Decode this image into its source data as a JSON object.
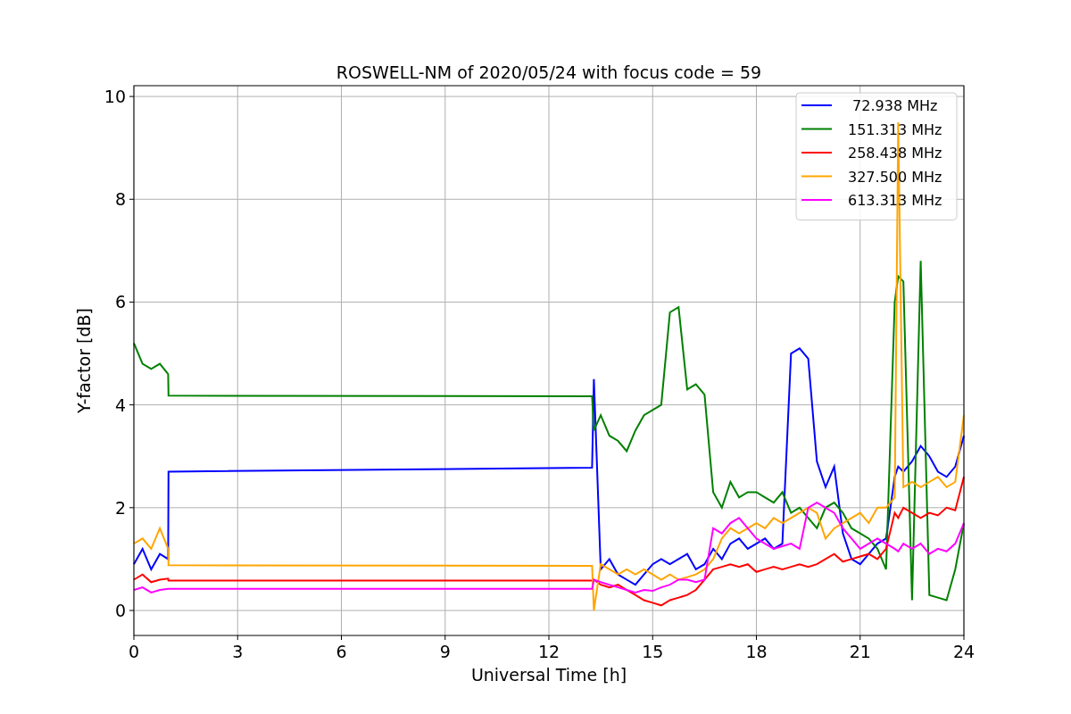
{
  "chart_data": {
    "type": "line",
    "title": "ROSWELL-NM of 2020/05/24 with focus code = 59",
    "xlabel": "Universal Time [h]",
    "ylabel": "Y-factor [dB]",
    "x": [
      0,
      0.25,
      0.5,
      0.75,
      0.99,
      1.0,
      13.25,
      13.3,
      13.5,
      13.75,
      14,
      14.25,
      14.5,
      14.75,
      15,
      15.25,
      15.5,
      15.75,
      16,
      16.25,
      16.5,
      16.75,
      17,
      17.25,
      17.5,
      17.75,
      18,
      18.25,
      18.5,
      18.75,
      19,
      19.25,
      19.5,
      19.75,
      20,
      20.25,
      20.5,
      20.75,
      21,
      21.25,
      21.5,
      21.75,
      22,
      22.1,
      22.25,
      22.5,
      22.75,
      23,
      23.25,
      23.5,
      23.75,
      24
    ],
    "series": [
      {
        "name": " 72.938 MHz",
        "color": "#0000ff",
        "values": [
          0.9,
          1.2,
          0.8,
          1.1,
          1.0,
          2.7,
          2.78,
          4.5,
          0.8,
          1.0,
          0.7,
          0.6,
          0.5,
          0.7,
          0.9,
          1.0,
          0.9,
          1.0,
          1.1,
          0.8,
          0.9,
          1.2,
          1.0,
          1.3,
          1.4,
          1.2,
          1.3,
          1.4,
          1.2,
          1.3,
          5.0,
          5.1,
          4.9,
          2.9,
          2.4,
          2.8,
          1.5,
          1.0,
          0.9,
          1.1,
          1.3,
          1.4,
          2.6,
          2.8,
          2.7,
          2.9,
          3.2,
          3.0,
          2.7,
          2.6,
          2.8,
          3.4
        ]
      },
      {
        "name": "151.313 MHz",
        "color": "#008000",
        "values": [
          5.2,
          4.8,
          4.7,
          4.8,
          4.6,
          4.18,
          4.17,
          3.5,
          3.8,
          3.4,
          3.3,
          3.1,
          3.5,
          3.8,
          3.9,
          4.0,
          5.8,
          5.9,
          4.3,
          4.4,
          4.2,
          2.3,
          2.0,
          2.5,
          2.2,
          2.3,
          2.3,
          2.2,
          2.1,
          2.3,
          1.9,
          2.0,
          1.8,
          1.6,
          2.0,
          2.1,
          1.9,
          1.6,
          1.5,
          1.4,
          1.2,
          0.8,
          6.0,
          6.5,
          6.4,
          0.2,
          6.8,
          0.3,
          0.25,
          0.2,
          0.8,
          1.7
        ]
      },
      {
        "name": "258.438 MHz",
        "color": "#ff0000",
        "values": [
          0.6,
          0.7,
          0.55,
          0.6,
          0.62,
          0.58,
          0.58,
          0.6,
          0.5,
          0.45,
          0.5,
          0.4,
          0.3,
          0.2,
          0.15,
          0.1,
          0.2,
          0.25,
          0.3,
          0.4,
          0.6,
          0.8,
          0.85,
          0.9,
          0.85,
          0.9,
          0.75,
          0.8,
          0.85,
          0.8,
          0.85,
          0.9,
          0.85,
          0.9,
          1.0,
          1.1,
          0.95,
          1.0,
          1.05,
          1.1,
          1.0,
          1.2,
          1.9,
          1.8,
          2.0,
          1.9,
          1.8,
          1.9,
          1.85,
          2.0,
          1.95,
          2.6
        ]
      },
      {
        "name": "327.500 MHz",
        "color": "#ffa500",
        "values": [
          1.3,
          1.4,
          1.2,
          1.6,
          1.2,
          0.88,
          0.87,
          0.0,
          0.9,
          0.8,
          0.7,
          0.8,
          0.7,
          0.8,
          0.7,
          0.6,
          0.7,
          0.6,
          0.65,
          0.7,
          0.8,
          1.0,
          1.4,
          1.6,
          1.5,
          1.6,
          1.7,
          1.6,
          1.8,
          1.7,
          1.8,
          1.9,
          2.0,
          1.9,
          1.4,
          1.6,
          1.7,
          1.8,
          1.9,
          1.7,
          2.0,
          2.0,
          2.2,
          9.5,
          2.4,
          2.5,
          2.4,
          2.5,
          2.6,
          2.4,
          2.5,
          3.8
        ]
      },
      {
        "name": "613.313 MHz",
        "color": "#ff00ff",
        "values": [
          0.4,
          0.45,
          0.35,
          0.4,
          0.42,
          0.42,
          0.42,
          0.6,
          0.55,
          0.5,
          0.45,
          0.4,
          0.35,
          0.4,
          0.38,
          0.45,
          0.5,
          0.6,
          0.6,
          0.55,
          0.6,
          1.6,
          1.5,
          1.7,
          1.8,
          1.6,
          1.4,
          1.3,
          1.2,
          1.25,
          1.3,
          1.2,
          2.0,
          2.1,
          2.0,
          1.9,
          1.6,
          1.4,
          1.2,
          1.3,
          1.4,
          1.3,
          1.2,
          1.15,
          1.3,
          1.2,
          1.3,
          1.1,
          1.2,
          1.15,
          1.3,
          1.7
        ]
      }
    ],
    "grid": true,
    "legend": true,
    "xlim": [
      0,
      24
    ],
    "ylim": [
      -0.486,
      10.21
    ],
    "xticks": [
      0,
      3,
      6,
      9,
      12,
      15,
      18,
      21,
      24
    ],
    "yticks": [
      0,
      2,
      4,
      6,
      8,
      10
    ]
  }
}
